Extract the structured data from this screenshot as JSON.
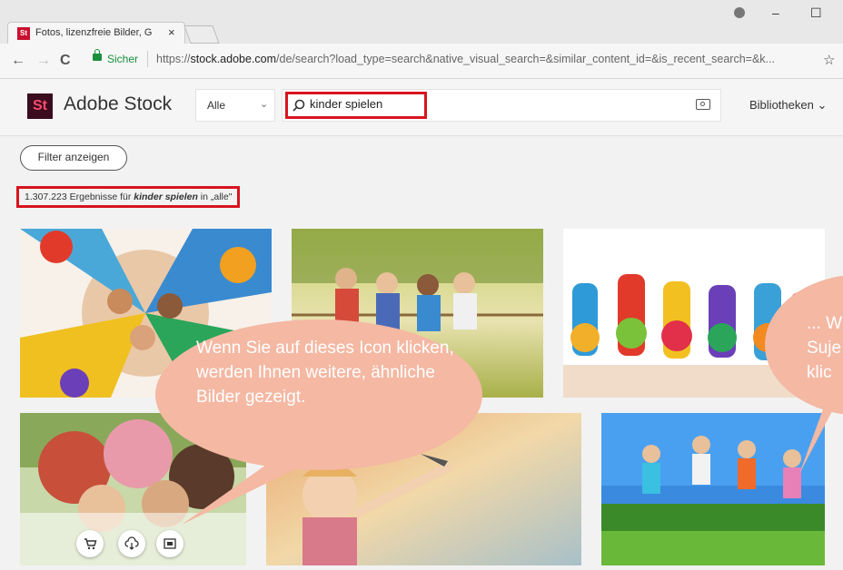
{
  "browser": {
    "tab_title": "Fotos, lizenzfreie Bilder, G",
    "tab_close": "×",
    "secure_label": "Sicher",
    "url_prefix": "https://",
    "url_host": "stock.adobe.com",
    "url_path": "/de/search?load_type=search&native_visual_search=&similar_content_id=&is_recent_search=&k...",
    "star": "☆",
    "nav_back": "←",
    "nav_forward": "→",
    "nav_reload": "C",
    "win_minimize": "–",
    "win_maximize": "☐"
  },
  "site": {
    "logo": "St",
    "brand": "Adobe Stock",
    "scope_selected": "Alle",
    "search_value": "kinder spielen",
    "libraries": "Bibliotheken ⌄",
    "filter_button": "Filter anzeigen"
  },
  "results": {
    "count": "1.307.223",
    "text_before": "Ergebnisse für",
    "query": "kinder spielen",
    "text_after": "in „alle\""
  },
  "callouts": {
    "main": "Wenn Sie auf dieses Icon klicken, werden Ihnen weitere, ähnliche Bilder gezeigt.",
    "right": "... W Suje klic"
  },
  "tile_actions": {
    "cart": "cart-icon",
    "license": "cloud-download-icon",
    "similar": "find-similar-icon"
  },
  "colors": {
    "highlight": "#d8141f",
    "callout": "#f4b8a3",
    "secure": "#1a8f3c"
  }
}
